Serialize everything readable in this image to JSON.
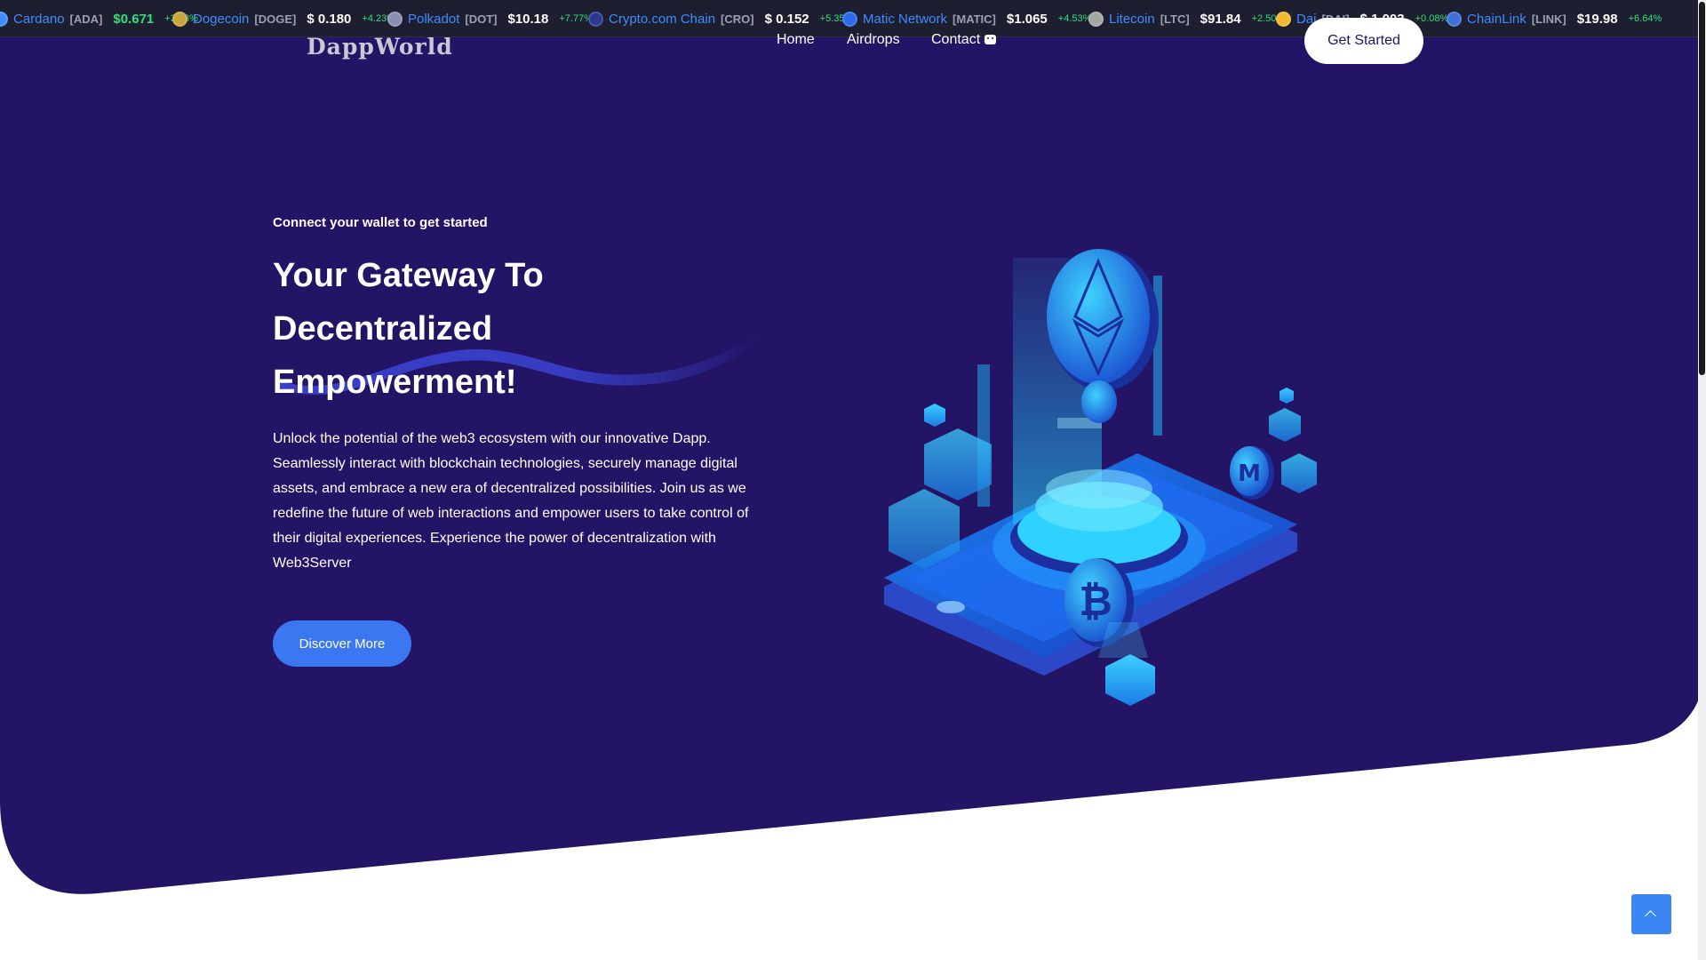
{
  "ticker": [
    {
      "name": "Cardano",
      "symbol": "[ADA]",
      "price": "$0.671",
      "change": "+3.38%",
      "icon_color": "#3f8cff",
      "price_up": true
    },
    {
      "name": "Dogecoin",
      "symbol": "[DOGE]",
      "price": "$ 0.180",
      "change": "+4.23%",
      "icon_color": "#c9a63b",
      "price_up": false
    },
    {
      "name": "Polkadot",
      "symbol": "[DOT]",
      "price": "$10.18",
      "change": "+7.77%",
      "icon_color": "#8a8fb0",
      "price_up": false
    },
    {
      "name": "Crypto.com Chain",
      "symbol": "[CRO]",
      "price": "$ 0.152",
      "change": "+5.35%",
      "icon_color": "#2a3b8f",
      "price_up": false
    },
    {
      "name": "Matic Network",
      "symbol": "[MATIC]",
      "price": "$1.065",
      "change": "+4.53%",
      "icon_color": "#2b6de8",
      "price_up": false
    },
    {
      "name": "Litecoin",
      "symbol": "[LTC]",
      "price": "$91.84",
      "change": "+2.50%",
      "icon_color": "#a5a5a5",
      "price_up": false
    },
    {
      "name": "Dai",
      "symbol": "[DAI]",
      "price": "$ 1.003",
      "change": "+0.08%",
      "icon_color": "#f4b731",
      "price_up": false
    },
    {
      "name": "ChainLink",
      "symbol": "[LINK]",
      "price": "$19.98",
      "change": "+6.64%",
      "icon_color": "#3f6fd8",
      "price_up": false
    }
  ],
  "nav": {
    "logo": "DappWorld",
    "home": "Home",
    "airdrops": "Airdrops",
    "contact": "Contact",
    "get_started": "Get Started"
  },
  "hero": {
    "eyebrow": "Connect your wallet to get started",
    "headline": [
      "Your Gateway To",
      "Decentralized",
      "Empowerment!"
    ],
    "intro": "Unlock the potential of the web3 ecosystem with our innovative Dapp. Seamlessly interact with blockchain technologies, securely manage digital assets, and embrace a new era of decentralized possibilities. Join us as we redefine the future of web interactions and empower users to take control of their digital experiences. Experience the power of decentralization with Web3Server",
    "cta": "Discover More"
  },
  "colors": {
    "hero_bg": "#241466",
    "ticker_bg": "#1d1e30",
    "accent": "#3a77f0",
    "ticker_name": "#3f8cff",
    "positive": "#2fe07a"
  }
}
